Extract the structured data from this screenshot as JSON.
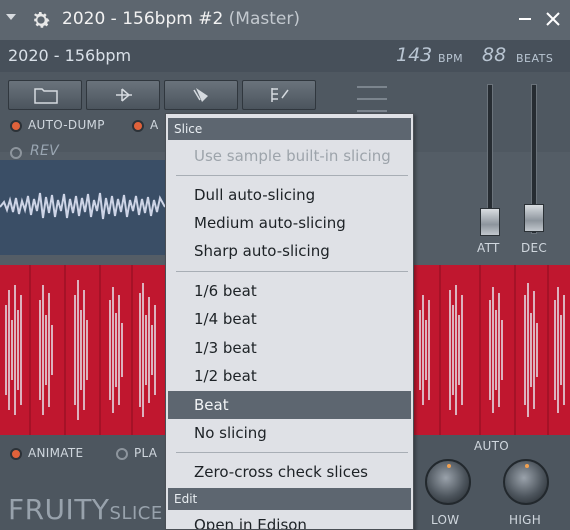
{
  "titlebar": {
    "title": "2020 - 156bpm #2",
    "owner": "(Master)"
  },
  "infobar": {
    "sample_name": "2020 - 156bpm",
    "bpm_value": "143",
    "bpm_unit": "BPM",
    "beats_value": "88",
    "beats_unit": "BEATS"
  },
  "toolbar": {
    "icons": [
      "folder-icon",
      "play-slice-icon",
      "slice-tool-icon",
      "marker-icon"
    ],
    "auto_dump_label": "AUTO-DUMP",
    "a_label": "A",
    "rev_label": "REV"
  },
  "sliders": {
    "att_label": "ATT",
    "dec_label": "DEC"
  },
  "bottom": {
    "animate_label": "ANIMATE",
    "play_label": "PLA",
    "auto_label": "AUTO",
    "low_label": "LOW",
    "high_label": "HIGH",
    "logo_main": "FRUITY",
    "logo_small": "SLICE"
  },
  "menu": {
    "slice_header": "Slice",
    "builtin": "Use sample built-in slicing",
    "dull": "Dull auto-slicing",
    "medium": "Medium auto-slicing",
    "sharp": "Sharp auto-slicing",
    "b16": "1/6 beat",
    "b14": "1/4 beat",
    "b13": "1/3 beat",
    "b12": "1/2 beat",
    "beat": "Beat",
    "noslice": "No slicing",
    "zerocross": "Zero-cross check slices",
    "edit_header": "Edit",
    "edison": "Open in Edison"
  },
  "colors": {
    "accent": "#e0623b",
    "wave_bg": "#c0172f",
    "menu_selected": "#5d6670"
  }
}
